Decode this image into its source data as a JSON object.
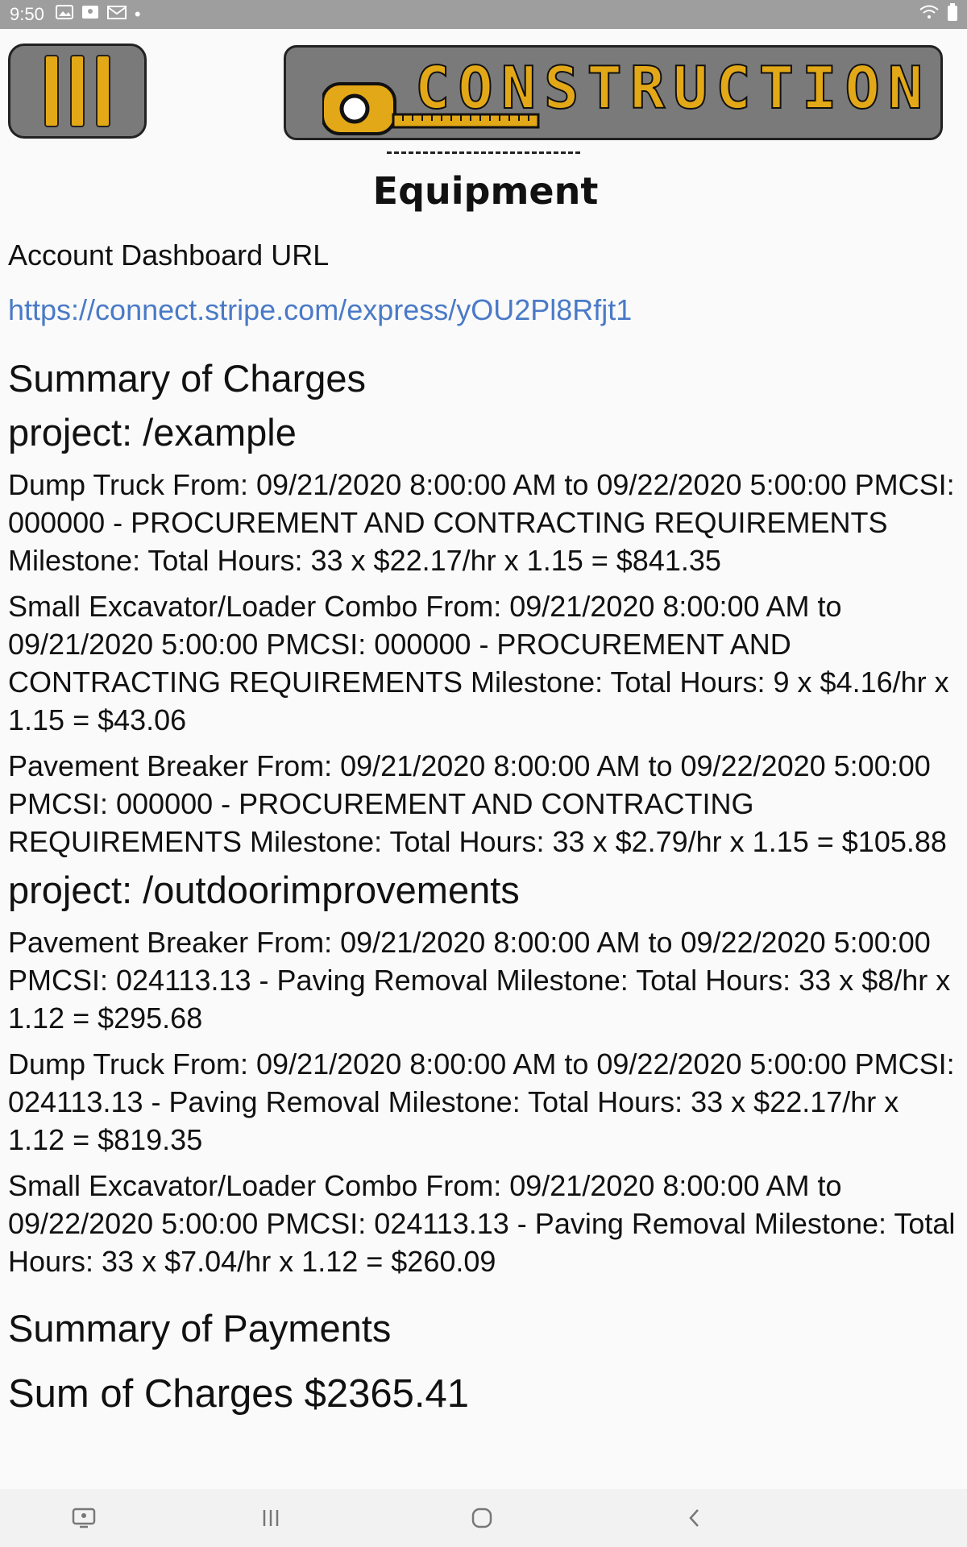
{
  "status_bar": {
    "time": "9:50",
    "dot": "•",
    "left_icons": [
      "gallery-icon",
      "photo-icon",
      "mail-icon"
    ],
    "right_icons": [
      "wifi-icon",
      "battery-icon"
    ]
  },
  "header": {
    "logo_text": "CONSTRUCTION",
    "logo_colors": {
      "bg": "#7a7a7a",
      "accent": "#e3a817"
    }
  },
  "page": {
    "title": "Equipment",
    "dashboard_label": "Account Dashboard URL",
    "dashboard_url": "https://connect.stripe.com/express/yOU2Pl8Rfjt1",
    "charges_title": "Summary of Charges",
    "projects": [
      {
        "name": "project: /example",
        "charges": [
          "Dump Truck From: 09/21/2020 8:00:00 AM to 09/22/2020 5:00:00 PMCSI: 000000 - PROCUREMENT AND CONTRACTING REQUIREMENTS Milestone: Total Hours: 33 x  $22.17/hr  x 1.15 = $841.35",
          "Small Excavator/Loader Combo From: 09/21/2020 8:00:00 AM to 09/21/2020 5:00:00 PMCSI: 000000 - PROCUREMENT AND CONTRACTING REQUIREMENTS Milestone: Total Hours: 9 x  $4.16/hr  x 1.15 = $43.06",
          "Pavement Breaker From: 09/21/2020 8:00:00 AM to 09/22/2020 5:00:00 PMCSI: 000000 - PROCUREMENT AND CONTRACTING REQUIREMENTS Milestone: Total Hours: 33 x  $2.79/hr  x 1.15 = $105.88"
        ]
      },
      {
        "name": "project: /outdoorimprovements",
        "charges": [
          "Pavement Breaker From: 09/21/2020 8:00:00 AM to 09/22/2020 5:00:00 PMCSI: 024113.13 -  Paving Removal Milestone: Total Hours: 33 x  $8/hr  x 1.12 = $295.68",
          "Dump Truck From: 09/21/2020 8:00:00 AM to 09/22/2020 5:00:00 PMCSI: 024113.13 -  Paving Removal Milestone: Total Hours: 33 x  $22.17/hr  x 1.12 = $819.35",
          "Small Excavator/Loader Combo From: 09/21/2020 8:00:00 AM to 09/22/2020 5:00:00 PMCSI: 024113.13 -  Paving Removal Milestone: Total Hours: 33 x  $7.04/hr  x 1.12 = $260.09"
        ]
      }
    ],
    "payments_title": "Summary of Payments",
    "sum_of_charges": "Sum of Charges $2365.41"
  },
  "nav_bar": {
    "buttons": [
      "screenshot-icon",
      "recent-apps-icon",
      "home-icon",
      "back-icon"
    ]
  }
}
